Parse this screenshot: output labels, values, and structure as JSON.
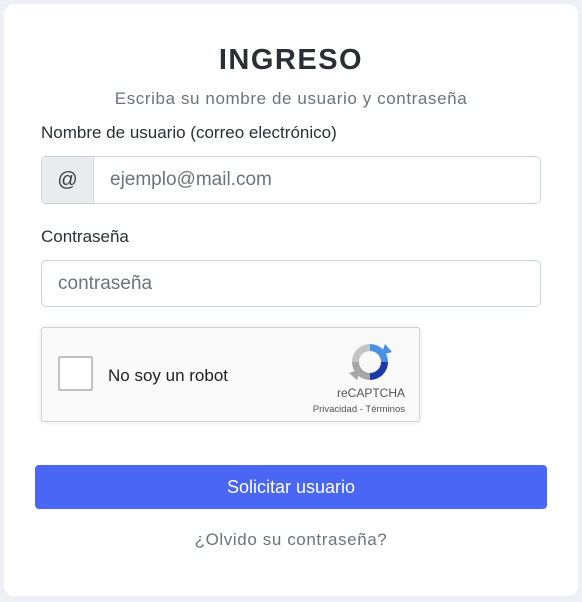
{
  "header": {
    "title": "INGRESO",
    "subtitle": "Escriba su nombre de usuario y contraseña"
  },
  "username": {
    "label": "Nombre de usuario (correo electrónico)",
    "addon": "@",
    "placeholder": "ejemplo@mail.com",
    "value": ""
  },
  "password": {
    "label": "Contraseña",
    "placeholder": "contraseña",
    "value": ""
  },
  "captcha": {
    "label": "No soy un robot",
    "brand": "reCAPTCHA",
    "privacy": "Privacidad",
    "separator": " - ",
    "terms": "Términos",
    "icon": "recaptcha-logo"
  },
  "actions": {
    "submit_label": "Solicitar usuario",
    "forgot_label": "¿Olvido su contraseña?"
  },
  "colors": {
    "primary": "#4a66f4",
    "background": "#eef0f5",
    "card": "#ffffff",
    "muted_text": "#6c737a"
  }
}
